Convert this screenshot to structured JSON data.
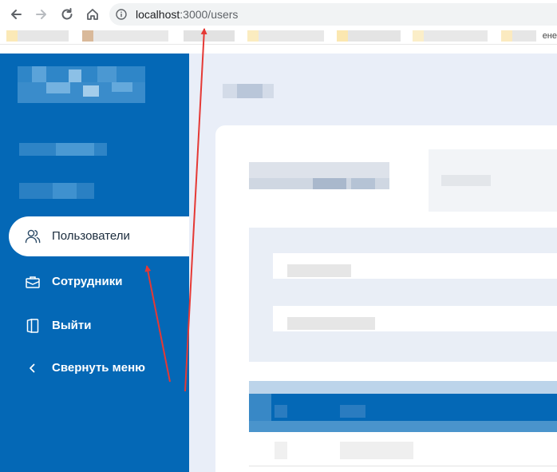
{
  "browser": {
    "url_host": "localhost",
    "url_rest": ":3000/users",
    "bookmark_overflow": "ене"
  },
  "sidebar": {
    "items": [
      {
        "label": "Пользователи",
        "icon": "users-icon",
        "active": true
      },
      {
        "label": "Сотрудники",
        "icon": "briefcase-icon",
        "active": false
      },
      {
        "label": "Выйти",
        "icon": "logout-icon",
        "active": false
      },
      {
        "label": "Свернуть меню",
        "icon": "chevron-left-icon",
        "active": false
      }
    ]
  },
  "colors": {
    "sidebar": "#0468b6",
    "main_bg": "#e9eef8",
    "annotation": "#e53935"
  }
}
